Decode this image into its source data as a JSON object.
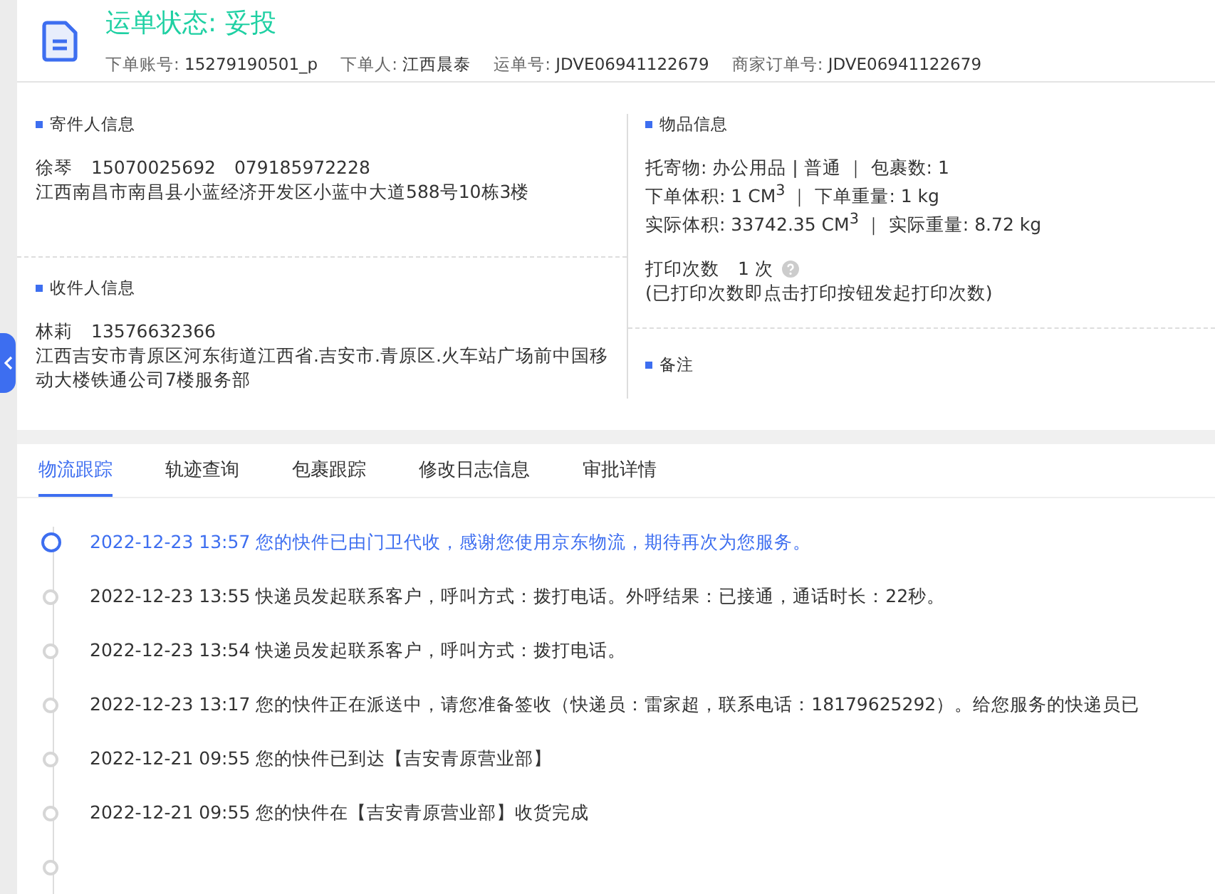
{
  "header": {
    "status": "运单状态: 妥投",
    "meta": [
      {
        "label": "下单账号:",
        "value": "15279190501_p"
      },
      {
        "label": "下单人:",
        "value": "江西晨泰"
      },
      {
        "label": "运单号:",
        "value": "JDVE06941122679"
      },
      {
        "label": "商家订单号:",
        "value": "JDVE06941122679"
      }
    ]
  },
  "sender": {
    "title": "寄件人信息",
    "contact": "徐琴　15070025692　079185972228",
    "address": "江西南昌市南昌县小蓝经济开发区小蓝中大道588号10栋3楼"
  },
  "receiver": {
    "title": "收件人信息",
    "contact": "林莉　13576632366",
    "address": "江西吉安市青原区河东街道江西省.吉安市.青原区.火车站广场前中国移动大楼铁通公司7楼服务部"
  },
  "goods": {
    "title": "物品信息",
    "lines": [
      "托寄物:  办公用品 | 普通 ｜ 包裹数:  1",
      "下单体积:   1 CM$^{3}$ ｜ 下单重量:  1 kg",
      "实际体积:   33742.35 CM$^{3}$ ｜ 实际重量:  8.72 kg"
    ],
    "print_label": "打印次数",
    "print_value": "1 次",
    "print_note": "(已打印次数即点击打印按钮发起打印次数)"
  },
  "remarks": {
    "title": "备注"
  },
  "tabs": [
    {
      "label": "物流跟踪",
      "selected": true
    },
    {
      "label": "轨迹查询",
      "selected": false
    },
    {
      "label": "包裹跟踪",
      "selected": false
    },
    {
      "label": "修改日志信息",
      "selected": false
    },
    {
      "label": "审批详情",
      "selected": false
    }
  ],
  "timeline": [
    {
      "text": "2022-12-23 13:57 您的快件已由门卫代收，感谢您使用京东物流，期待再次为您服务。",
      "selected": true
    },
    {
      "text": "2022-12-23 13:55 快递员发起联系客户，呼叫方式：拨打电话。外呼结果：已接通，通话时长：22秒。",
      "selected": false
    },
    {
      "text": "2022-12-23 13:54 快递员发起联系客户，呼叫方式：拨打电话。",
      "selected": false
    },
    {
      "text": "2022-12-23 13:17 您的快件正在派送中，请您准备签收（快递员：雷家超，联系电话：18179625292）。给您服务的快递员已",
      "selected": false
    },
    {
      "text": "2022-12-21 09:55 您的快件已到达【吉安青原营业部】",
      "selected": false
    },
    {
      "text": "2022-12-21 09:55 您的快件在【吉安青原营业部】收货完成",
      "selected": false
    }
  ]
}
